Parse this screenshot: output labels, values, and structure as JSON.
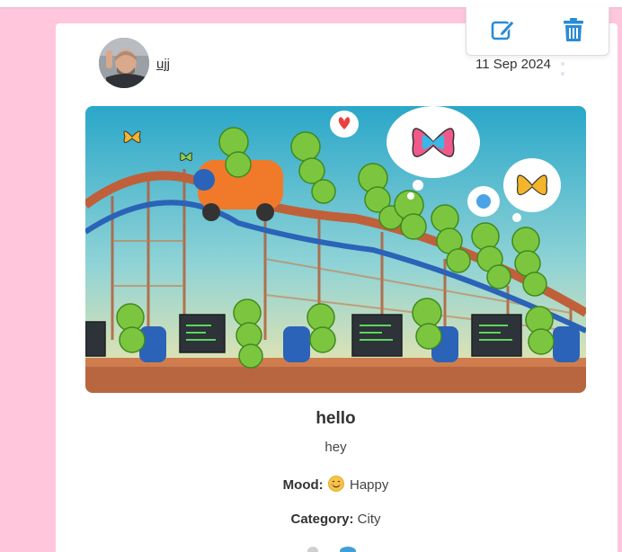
{
  "post": {
    "author": "ujj",
    "date": "11 Sep 2024",
    "title": "hello",
    "body": "hey",
    "mood_label": "Mood:",
    "mood_value": "Happy",
    "mood_icon": "smiling-face-icon",
    "category_label": "Category:",
    "category_value": "City"
  },
  "actions": {
    "edit_icon": "edit-icon",
    "delete_icon": "trash-icon"
  },
  "colors": {
    "background": "#ffc6dc",
    "card": "#ffffff",
    "accent_blue": "#2a8bd6"
  }
}
